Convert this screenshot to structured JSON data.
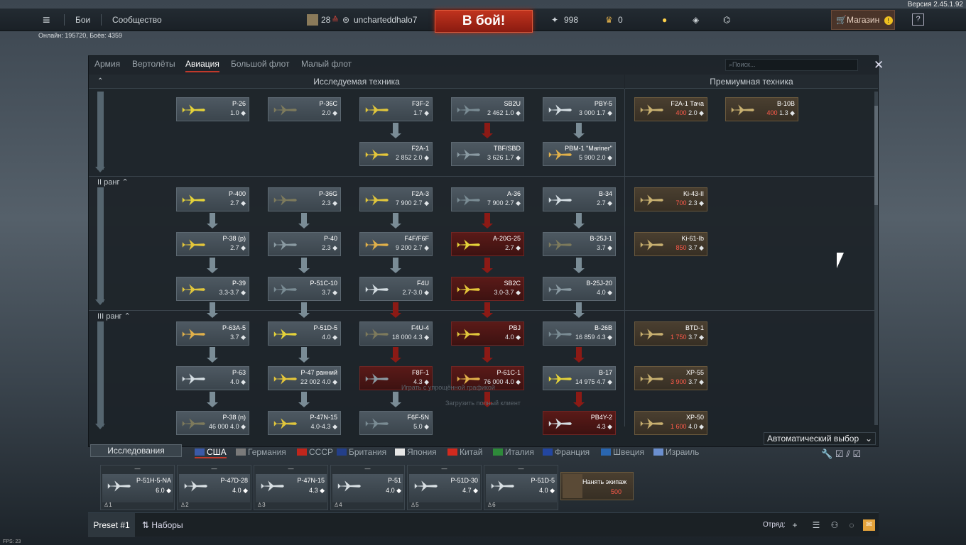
{
  "version": "Версия 2.45.1.92",
  "online": "Онлайн: 195720, Боёв: 4359",
  "fps": "FPS: 23",
  "top": {
    "battles": "Бои",
    "community": "Сообщество",
    "level": "28",
    "username": "uncharteddhalo7",
    "battle_button": "В бой!",
    "silver": "998",
    "eagles": "0",
    "shop": "Магазин",
    "help": "?"
  },
  "tabs": [
    "Армия",
    "Вертолёты",
    "Авиация",
    "Большой флот",
    "Малый флот"
  ],
  "search_placeholder": "Поиск...",
  "researched_header": "Исследуемая техника",
  "premium_header": "Премиумная техника",
  "ranks": {
    "r2": "II ранг",
    "r3": "III ранг"
  },
  "tree": [
    {
      "name": "P-26",
      "val": "1.0"
    },
    {
      "name": "P-36C",
      "val": "2.0"
    },
    {
      "name": "F3F-2",
      "val": "1.7"
    },
    {
      "name": "SB2U",
      "val": "2 462 1.0"
    },
    {
      "name": "PBY-5",
      "val": "3 000 1.7"
    },
    {
      "name": "F2A-1",
      "val": "2 852 2.0"
    },
    {
      "name": "TBF/SBD",
      "val": "3 626 1.7"
    },
    {
      "name": "PBM-1 \"Mariner\"",
      "val": "5 900 2.0"
    },
    {
      "name": "P-400",
      "val": "2.7"
    },
    {
      "name": "P-36G",
      "val": "2.3"
    },
    {
      "name": "F2A-3",
      "val": "7 900 2.7"
    },
    {
      "name": "A-36",
      "val": "7 900 2.7"
    },
    {
      "name": "B-34",
      "val": "2.7"
    },
    {
      "name": "P-38 (p)",
      "val": "2.7"
    },
    {
      "name": "P-40",
      "val": "2.3"
    },
    {
      "name": "F4F/F6F",
      "val": "9 200 2.7"
    },
    {
      "name": "A-20G-25",
      "val": "2.7"
    },
    {
      "name": "B-25J-1",
      "val": "3.7"
    },
    {
      "name": "P-39",
      "val": "3.3-3.7"
    },
    {
      "name": "P-51C-10",
      "val": "3.7"
    },
    {
      "name": "F4U",
      "val": "2.7-3.0"
    },
    {
      "name": "SB2C",
      "val": "3.0-3.7"
    },
    {
      "name": "B-25J-20",
      "val": "4.0"
    },
    {
      "name": "P-63A-5",
      "val": "3.7"
    },
    {
      "name": "P-51D-5",
      "val": "4.0"
    },
    {
      "name": "F4U-4",
      "val": "18 000 4.3"
    },
    {
      "name": "PBJ",
      "val": "4.0"
    },
    {
      "name": "B-26B",
      "val": "16 859 4.3"
    },
    {
      "name": "P-63",
      "val": "4.0"
    },
    {
      "name": "P-47 ранний",
      "val": "22 002 4.0"
    },
    {
      "name": "F8F-1",
      "val": "4.3"
    },
    {
      "name": "P-61C-1",
      "val": "76 000 4.0"
    },
    {
      "name": "B-17",
      "val": "14 975 4.7"
    },
    {
      "name": "P-38 (n)",
      "val": "46 000 4.0"
    },
    {
      "name": "P-47N-15",
      "val": "4.0-4.3"
    },
    {
      "name": "F6F-5N",
      "val": "5.0"
    },
    {
      "name": "PB4Y-2",
      "val": "4.3"
    }
  ],
  "premium": [
    {
      "name": "F2A-1 Тача",
      "gold": "400",
      "val": "2.0"
    },
    {
      "name": "B-10B",
      "gold": "400",
      "val": "1.3"
    },
    {
      "name": "Ki-43-II",
      "gold": "700",
      "val": "2.3"
    },
    {
      "name": "Ki-61-Ib",
      "gold": "850",
      "val": "3.7"
    },
    {
      "name": "BTD-1",
      "gold": "1 750",
      "val": "3.7"
    },
    {
      "name": "XP-55",
      "gold": "3 900",
      "val": "3.7"
    },
    {
      "name": "XP-50",
      "gold": "1 600",
      "val": "4.0"
    }
  ],
  "overlay": [
    "Играть с упрощённой графикой",
    "Загрузить полный клиент"
  ],
  "auto_select": "Автоматический выбор",
  "research_button": "Исследования",
  "nations": [
    {
      "name": "США",
      "color": "#3b5aa8"
    },
    {
      "name": "Германия",
      "color": "#7a7a7a"
    },
    {
      "name": "СССР",
      "color": "#c0261c"
    },
    {
      "name": "Британия",
      "color": "#233f8a"
    },
    {
      "name": "Япония",
      "color": "#e6e6e6"
    },
    {
      "name": "Китай",
      "color": "#d12a1e"
    },
    {
      "name": "Италия",
      "color": "#2e8a3a"
    },
    {
      "name": "Франция",
      "color": "#2346a0"
    },
    {
      "name": "Швеция",
      "color": "#2a66b0"
    },
    {
      "name": "Израиль",
      "color": "#6b8fcf"
    }
  ],
  "crew": [
    {
      "name": "P-51H-5-NA",
      "br": "6.0",
      "slot": "1"
    },
    {
      "name": "P-47D-28",
      "br": "4.0",
      "slot": "2"
    },
    {
      "name": "P-47N-15",
      "br": "4.3",
      "slot": "3"
    },
    {
      "name": "P-51",
      "br": "4.0",
      "slot": "4"
    },
    {
      "name": "P-51D-30",
      "br": "4.7",
      "slot": "5"
    },
    {
      "name": "P-51D-5",
      "br": "4.0",
      "slot": "6"
    }
  ],
  "hire": {
    "label": "Нанять экипаж",
    "price": "500"
  },
  "bottom": {
    "preset": "Preset #1",
    "sets": "Наборы",
    "squad": "Отряд:"
  }
}
